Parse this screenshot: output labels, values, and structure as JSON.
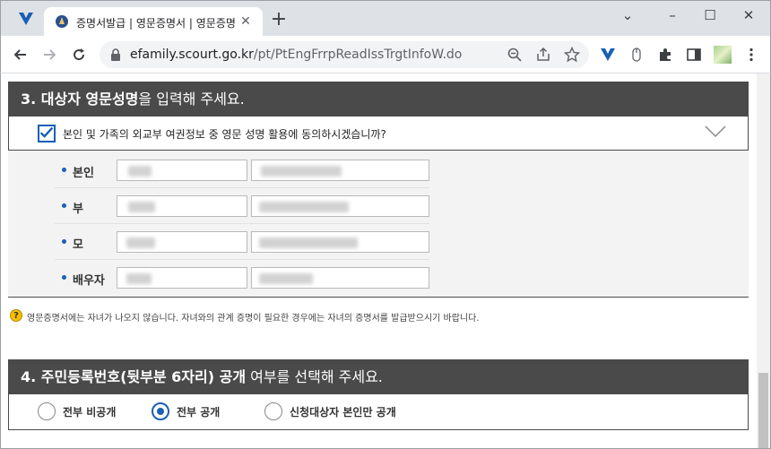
{
  "browser": {
    "tab_title": "증명서발급 | 영문증명서 | 영문증명서",
    "url_host": "efamily.scourt.go.kr",
    "url_path": "/pt/PtEngFrrpReadIssTrgtInfoW.do",
    "close_glyph": "✕",
    "new_tab_glyph": "+",
    "minimize_glyph": "–",
    "maximize_glyph": "☐",
    "window_close_glyph": "✕",
    "chevron_glyph": "⌄"
  },
  "section3": {
    "number": "3.",
    "title_bold": "대상자 영문성명",
    "title_rest": "을 입력해 주세요.",
    "consent_label": "본인 및 가족의 외교부 여권정보 중 영문 성명 활용에 동의하시겠습니까?",
    "consent_checked": true,
    "rows": [
      {
        "label": "본인"
      },
      {
        "label": "부"
      },
      {
        "label": "모"
      },
      {
        "label": "배우자"
      }
    ],
    "notice_icon": "?",
    "notice": "영문증명서에는 자녀가 나오지 않습니다. 자녀와의 관계 증명이 필요한 경우에는 자녀의 증명서를 발급받으시기 바랍니다."
  },
  "section4": {
    "number": "4.",
    "title_bold": "주민등록번호(뒷부분 6자리) 공개",
    "title_rest": " 여부를 선택해 주세요.",
    "options": [
      {
        "label": "전부 비공개",
        "selected": false
      },
      {
        "label": "전부 공개",
        "selected": true
      },
      {
        "label": "신청대상자 본인만 공개",
        "selected": false
      }
    ]
  },
  "colors": {
    "header_bg": "#4a4a4a",
    "accent": "#1a5fb4",
    "names_bg": "#f3f3f3"
  }
}
